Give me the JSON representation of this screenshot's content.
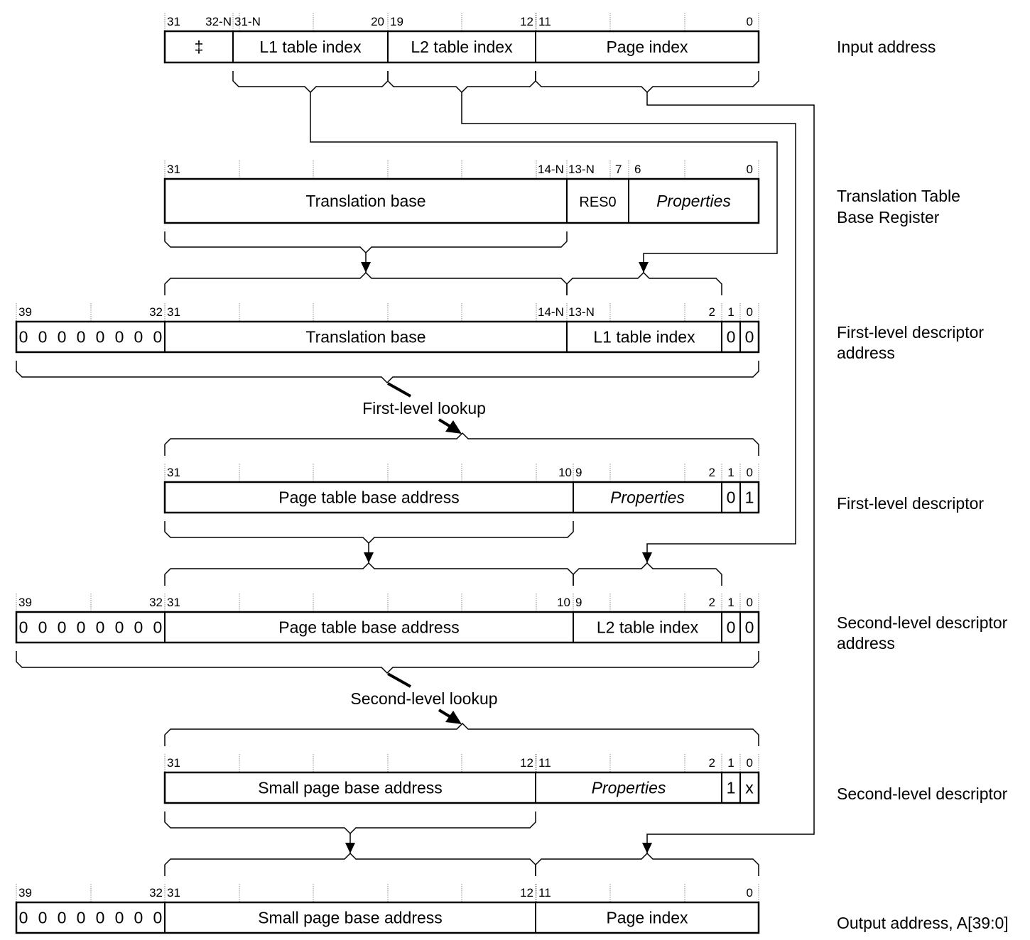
{
  "rows": [
    {
      "label": [
        "Input address"
      ],
      "bits": [
        "31",
        "32-N",
        "31-N",
        "20",
        "19",
        "12",
        "11",
        "0"
      ],
      "fields": [
        "‡",
        "L1 table index",
        "L2 table index",
        "Page index"
      ]
    },
    {
      "label": [
        "Translation Table",
        "Base Register"
      ],
      "bits": [
        "31",
        "14-N",
        "13-N",
        "7",
        "6",
        "0"
      ],
      "fields": [
        "Translation base",
        "RES0",
        "Properties"
      ]
    },
    {
      "label": [
        "First-level descriptor",
        "address"
      ],
      "bits": [
        "39",
        "32",
        "31",
        "14-N",
        "13-N",
        "2",
        "1",
        "0"
      ],
      "fields": [
        "0 0 0 0 0 0 0 0",
        "Translation base",
        "L1 table index",
        "0",
        "0"
      ]
    },
    {
      "label": [
        "First-level descriptor"
      ],
      "bits": [
        "31",
        "10",
        "9",
        "2",
        "1",
        "0"
      ],
      "fields": [
        "Page table base address",
        "Properties",
        "0",
        "1"
      ]
    },
    {
      "label": [
        "Second-level descriptor",
        "address"
      ],
      "bits": [
        "39",
        "32",
        "31",
        "10",
        "9",
        "2",
        "1",
        "0"
      ],
      "fields": [
        "0 0 0 0 0 0 0 0",
        "Page table base address",
        "L2 table index",
        "0",
        "0"
      ]
    },
    {
      "label": [
        "Second-level descriptor"
      ],
      "bits": [
        "31",
        "12",
        "11",
        "2",
        "1",
        "0"
      ],
      "fields": [
        "Small page base address",
        "Properties",
        "1",
        "x"
      ]
    },
    {
      "label": [
        "Output address, A[39:0]"
      ],
      "bits": [
        "39",
        "32",
        "31",
        "12",
        "11",
        "0"
      ],
      "fields": [
        "0 0 0 0 0 0 0 0",
        "Small page base address",
        "Page index"
      ]
    }
  ],
  "lookups": [
    "First-level lookup",
    "Second-level lookup"
  ]
}
